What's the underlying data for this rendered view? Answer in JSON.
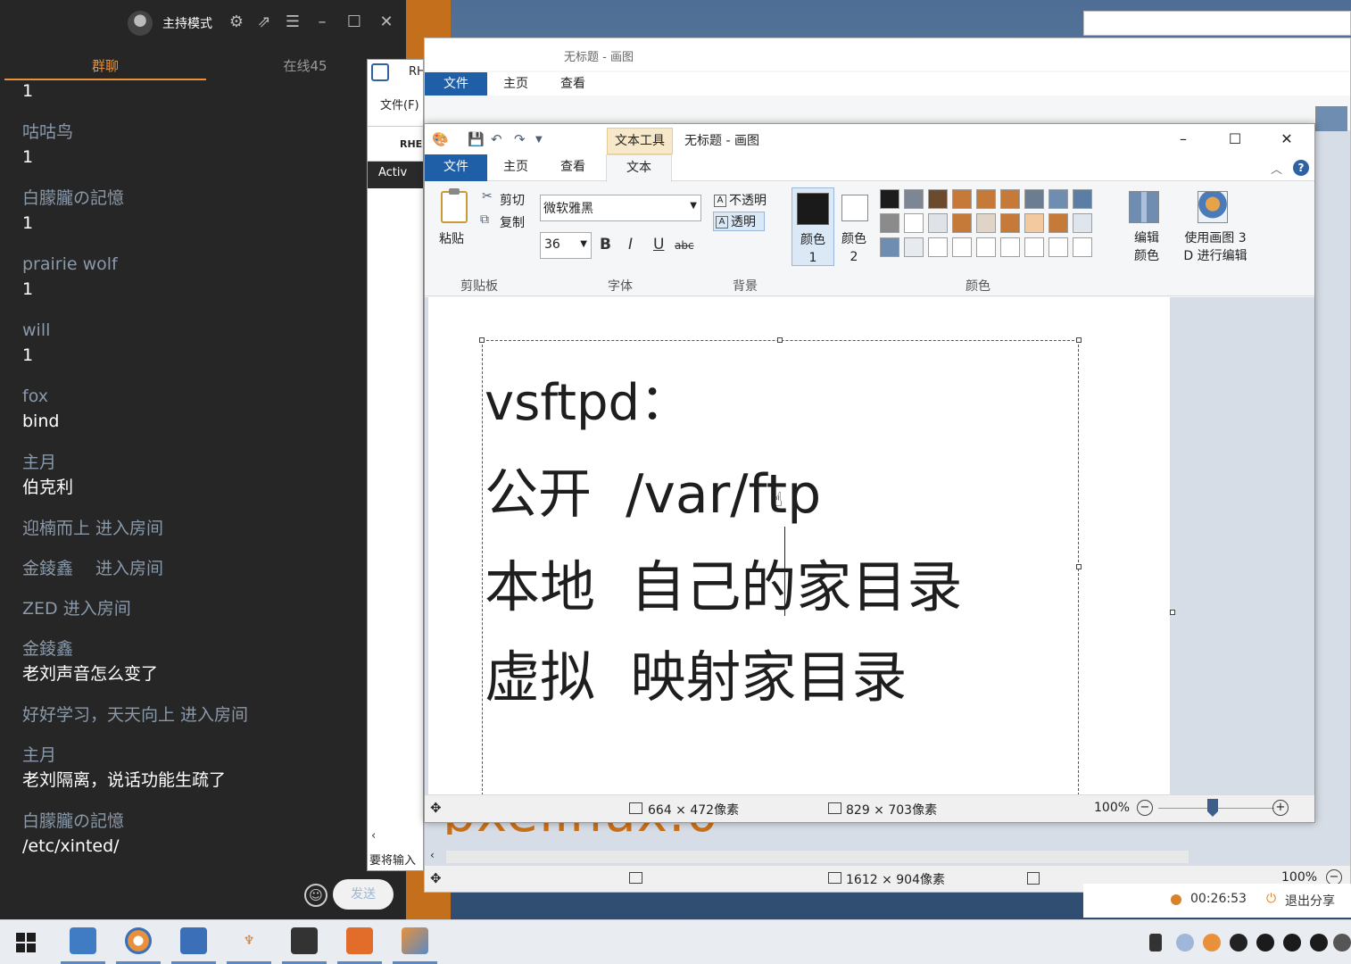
{
  "chat": {
    "mode_label": "主持模式",
    "tabs": {
      "group": "群聊",
      "online": "在线45"
    },
    "messages": [
      {
        "name": "",
        "text": "1"
      },
      {
        "name": "咕咕鸟",
        "text": "1"
      },
      {
        "name": "白朦朧の記憶",
        "text": "1"
      },
      {
        "name": "prairie wolf",
        "text": "1"
      },
      {
        "name": "will",
        "text": "1"
      },
      {
        "name": "fox",
        "text": "bind"
      },
      {
        "name": "主月",
        "text": "伯克利"
      }
    ],
    "notices": [
      "迎楠而上 进入房间",
      "金錂鑫　 进入房间",
      "ZED 进入房间"
    ],
    "messages2": [
      {
        "name": "金錂鑫",
        "text": "老刘声音怎么变了"
      }
    ],
    "notice2": "好好学习，天天向上 进入房间",
    "messages3": [
      {
        "name": "主月",
        "text": "老刘隔离，说话功能生疏了"
      },
      {
        "name": "白朦朧の記憶",
        "text": "/etc/xinted/"
      }
    ],
    "send_label": "发送"
  },
  "rhel_window": {
    "title": "RH",
    "menu": "文件(F)",
    "tab_label": "RHEL",
    "activities": "Activ",
    "status": "要将输入"
  },
  "paint_back": {
    "title": "无标题 - 画图",
    "tabs": {
      "file": "文件",
      "home": "主页",
      "view": "查看"
    },
    "right_labels": [
      "编辑",
      "颜色"
    ],
    "orange_text": "pxelinux.0",
    "status_size": "1612 × 904像素",
    "zoom": "100%"
  },
  "paint": {
    "context_tab": "文本工具",
    "title": "无标题 - 画图",
    "tabs": {
      "file": "文件",
      "home": "主页",
      "view": "查看",
      "text": "文本"
    },
    "clipboard": {
      "paste": "粘贴",
      "cut": "剪切",
      "copy": "复制",
      "group": "剪贴板"
    },
    "font": {
      "family": "微软雅黑",
      "size": "36",
      "bold": "B",
      "italic": "I",
      "underline": "U",
      "strike": "abc",
      "group": "字体"
    },
    "background": {
      "opaque": "不透明",
      "transparent": "透明",
      "group": "背景"
    },
    "colors": {
      "color1": "颜色 1",
      "color2": "颜色 2",
      "group": "颜色",
      "edit_colors": "编辑颜色",
      "paint3d": "使用画图 3 D 进行编辑",
      "palette": [
        "#1c1c1c",
        "#7d8793",
        "#6b4a2e",
        "#c57a3a",
        "#c57a3a",
        "#c57a3a",
        "#6d7d91",
        "#6e8db0",
        "#5b7ea5",
        "#8b8b8b",
        "#ffffff",
        "#dfe3e8",
        "#c57a3a",
        "#e0d4c8",
        "#c57a3a",
        "#f3c9a0",
        "#c57a3a",
        "#dfe5ec",
        "#6e8db0",
        "#e7ebf0",
        "#ffffff",
        "#ffffff",
        "#ffffff",
        "#ffffff",
        "#ffffff",
        "#ffffff",
        "#ffffff",
        "#ffffff",
        "#ffffff",
        "#ffffff"
      ]
    },
    "canvas_lines": [
      "vsftpd：",
      "公开  /var/ftp",
      "本地  自己的家目录",
      "虚拟  映射家目录"
    ],
    "status": {
      "selection_size": "664 × 472像素",
      "image_size": "829 × 703像素",
      "zoom": "100%"
    }
  },
  "recording": {
    "time": "00:26:53",
    "exit": "退出分享"
  }
}
